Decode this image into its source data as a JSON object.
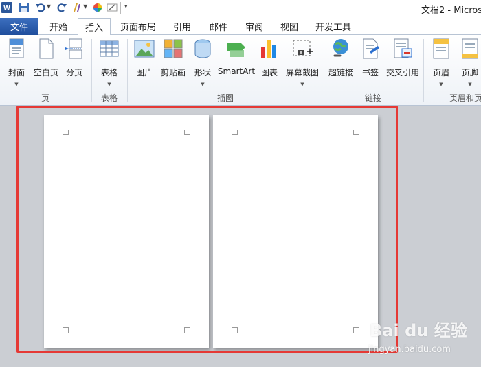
{
  "window": {
    "title": "文档2 - Micros"
  },
  "tabs": {
    "file": "文件",
    "items": [
      "开始",
      "插入",
      "页面布局",
      "引用",
      "邮件",
      "审阅",
      "视图",
      "开发工具"
    ],
    "active": "插入"
  },
  "ribbon": {
    "buttons": {
      "cover": "封面",
      "blank_page": "空白页",
      "page_break": "分页",
      "table": "表格",
      "picture": "图片",
      "clipart": "剪贴画",
      "shapes": "形状",
      "smartart": "SmartArt",
      "chart": "图表",
      "screenshot": "屏幕截图",
      "hyperlink": "超链接",
      "bookmark": "书签",
      "cross_reference": "交叉引用",
      "header": "页眉",
      "footer": "页脚"
    },
    "groups": {
      "pages": "页",
      "tables": "表格",
      "illustrations": "插图",
      "links": "链接",
      "header_footer": "页眉和页"
    }
  },
  "watermark": {
    "logo": "Bai du 经验",
    "url": "jingyan.baidu.com"
  },
  "colors": {
    "file_tab": "#2b579a",
    "highlight": "#e53935",
    "doc_bg": "#cbced3"
  }
}
